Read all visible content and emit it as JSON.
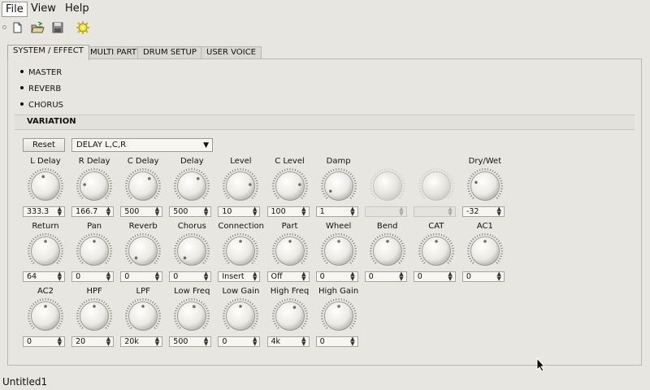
{
  "menu": [
    "File",
    "View",
    "Help"
  ],
  "tabs": [
    "SYSTEM / EFFECT",
    "MULTI PART",
    "DRUM SETUP",
    "USER VOICE"
  ],
  "sections": [
    "MASTER",
    "REVERB",
    "CHORUS"
  ],
  "variation": {
    "header": "VARIATION",
    "reset_label": "Reset",
    "type_value": "DELAY L,C,R",
    "rows": [
      [
        {
          "label": "L Delay",
          "value": "333.3",
          "angle": 0.45
        },
        {
          "label": "R Delay",
          "value": "166.7",
          "angle": 0.2
        },
        {
          "label": "C Delay",
          "value": "500",
          "angle": 0.65
        },
        {
          "label": "Delay",
          "value": "500",
          "angle": 0.65
        },
        {
          "label": "Level",
          "value": "10",
          "angle": 0.8
        },
        {
          "label": "C Level",
          "value": "100",
          "angle": 0.8
        },
        {
          "label": "Damp",
          "value": "1",
          "angle": 0.05
        },
        {
          "label": "",
          "value": "",
          "angle": 0.5,
          "disabled": true
        },
        {
          "label": "",
          "value": "",
          "angle": 0.5,
          "disabled": true
        },
        {
          "label": "Dry/Wet",
          "value": "-32",
          "angle": 0.25
        }
      ],
      [
        {
          "label": "Return",
          "value": "64",
          "angle": 0.5
        },
        {
          "label": "Pan",
          "value": "0",
          "angle": 0.5
        },
        {
          "label": "Reverb",
          "value": "0",
          "angle": 0.0
        },
        {
          "label": "Chorus",
          "value": "0",
          "angle": 0.0
        },
        {
          "label": "Connection",
          "value": "Insert",
          "angle": 0.5
        },
        {
          "label": "Part",
          "value": "Off",
          "angle": 0.5
        },
        {
          "label": "Wheel",
          "value": "0",
          "angle": 0.5
        },
        {
          "label": "Bend",
          "value": "0",
          "angle": 0.5
        },
        {
          "label": "CAT",
          "value": "0",
          "angle": 0.5
        },
        {
          "label": "AC1",
          "value": "0",
          "angle": 0.5
        }
      ],
      [
        {
          "label": "AC2",
          "value": "0",
          "angle": 0.5
        },
        {
          "label": "HPF",
          "value": "20",
          "angle": 0.5
        },
        {
          "label": "LPF",
          "value": "20k",
          "angle": 0.5
        },
        {
          "label": "Low Freq",
          "value": "500",
          "angle": 0.55
        },
        {
          "label": "Low Gain",
          "value": "0",
          "angle": 0.5
        },
        {
          "label": "High Freq",
          "value": "4k",
          "angle": 0.6
        },
        {
          "label": "High Gain",
          "value": "0",
          "angle": 0.5
        }
      ]
    ]
  },
  "status": "Untitled1"
}
